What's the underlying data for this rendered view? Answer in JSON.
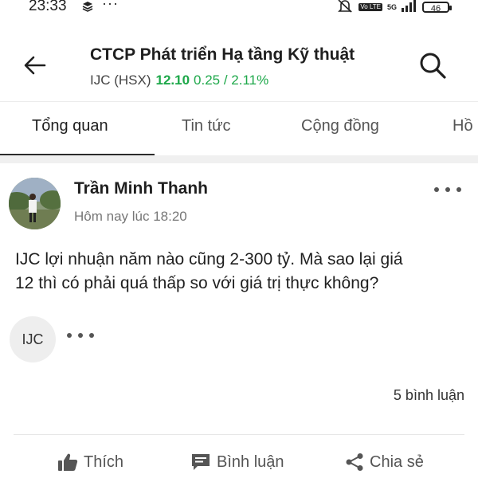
{
  "status_bar": {
    "time": "23:33",
    "dots": "···",
    "network_badge": "Vo LTE",
    "network_type": "5G",
    "battery": "46"
  },
  "header": {
    "title": "CTCP Phát triển Hạ tầng Kỹ thuật",
    "ticker": "IJC (HSX)",
    "price": "12.10",
    "change": "0.25 / 2.11%",
    "change_color": "#1ea84a"
  },
  "tabs": [
    {
      "label": "Tổng quan",
      "active": true
    },
    {
      "label": "Tin tức",
      "active": false
    },
    {
      "label": "Cộng đồng",
      "active": false
    },
    {
      "label": "Hồ",
      "active": false
    }
  ],
  "post": {
    "author": "Trần Minh Thanh",
    "timestamp": "Hôm nay lúc 18:20",
    "body_line1": "IJC lợi nhuận năm nào cũng 2-300 tỷ. Mà sao lại giá",
    "body_line2": "12 thì có phải quá thấp so với giá trị thực không?",
    "tag": "IJC",
    "comment_count": "5 bình luận",
    "actions": {
      "like": "Thích",
      "comment": "Bình luận",
      "share": "Chia sẻ"
    }
  },
  "icons": {
    "back": "arrow-left-icon",
    "search": "search-icon",
    "menu": "more-horizontal-icon",
    "like": "thumbs-up-icon",
    "comment": "chat-bubble-icon",
    "share": "share-icon"
  }
}
